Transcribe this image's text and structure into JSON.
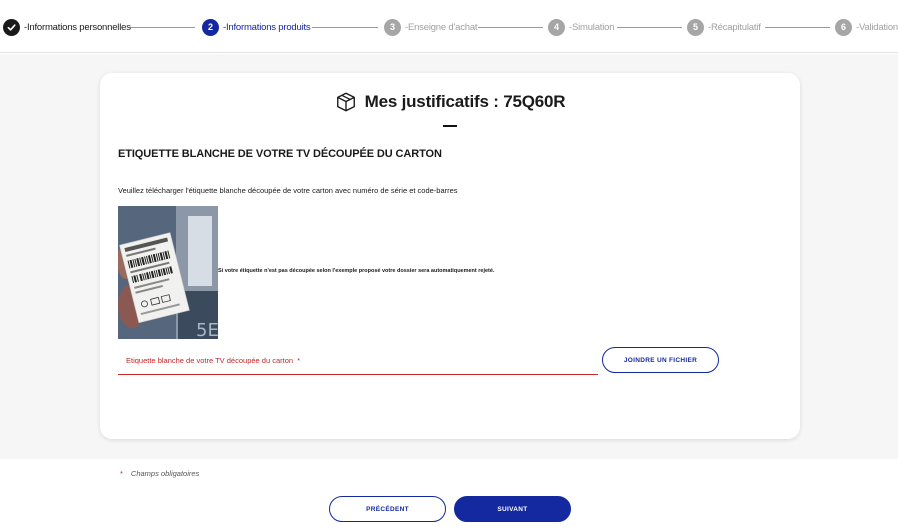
{
  "stepper": {
    "steps": [
      {
        "number": "",
        "label": "-Informations personnelles",
        "state": "done"
      },
      {
        "number": "2",
        "label": "-Informations produits",
        "state": "active"
      },
      {
        "number": "3",
        "label": "-Enseigne d'achat",
        "state": "pending"
      },
      {
        "number": "4",
        "label": "-Simulation",
        "state": "pending"
      },
      {
        "number": "5",
        "label": "-Récapitulatif",
        "state": "pending"
      },
      {
        "number": "6",
        "label": "-Validation",
        "state": "pending"
      }
    ]
  },
  "card": {
    "icon": "package-box-icon",
    "title": "Mes justificatifs : 75Q60R",
    "section_title": "ETIQUETTE BLANCHE DE VOTRE TV DÉCOUPÉE DU CARTON",
    "instructions": "Veuillez télécharger l'étiquette blanche découpée de votre carton avec numéro de série et code-barres",
    "warning": "Si votre étiquette n'est pas découpée selon l'exemple proposé votre dossier sera automatiquement rejeté.",
    "file_field": {
      "label": "Etiquette blanche de votre TV découpée du carton",
      "required_mark": "*"
    },
    "attach_button": "JOINDRE UN FICHIER"
  },
  "footer": {
    "required_star": "*",
    "required_note": "Champs obligatoires",
    "prev_button": "PRÉCÉDENT",
    "next_button": "SUIVANT"
  },
  "colors": {
    "primary": "#1428a0",
    "error": "#c62828",
    "inactive": "#a6a6a6",
    "background": "#f6f6f6"
  }
}
